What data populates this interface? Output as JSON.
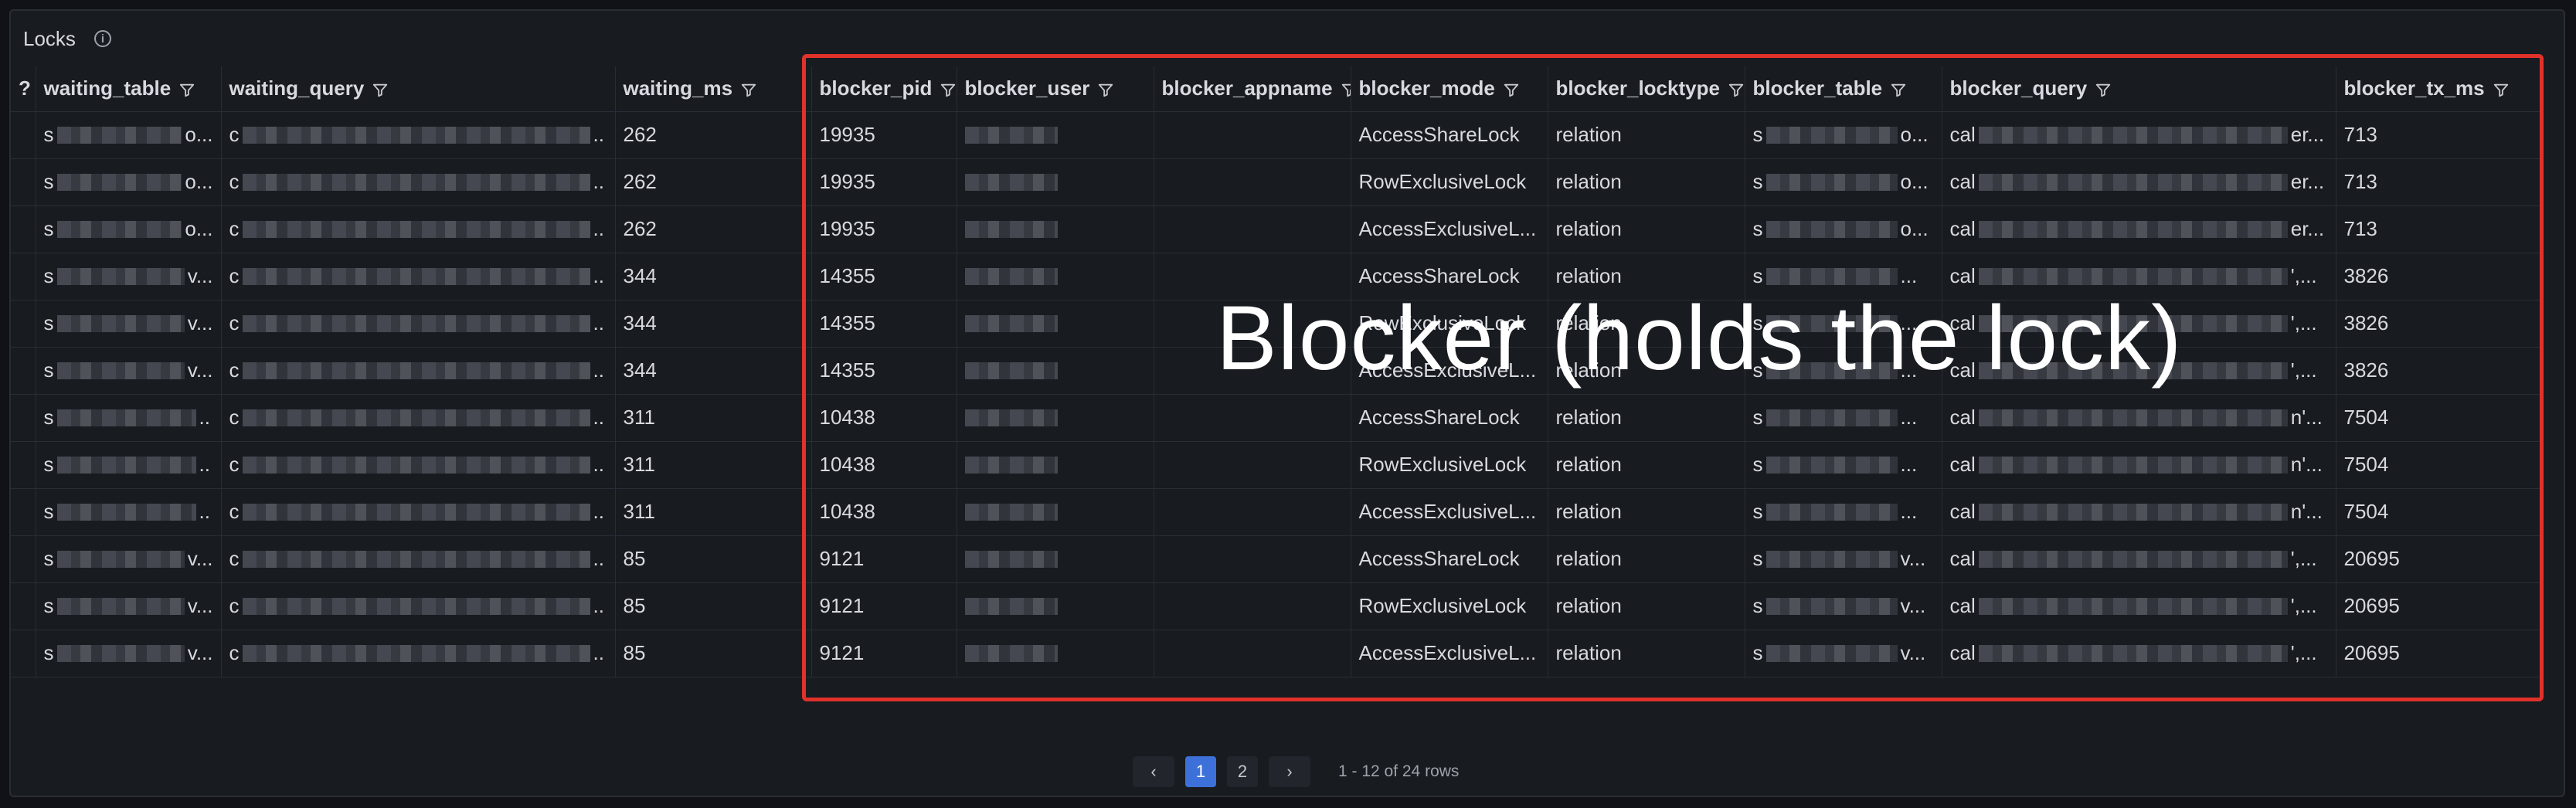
{
  "panel": {
    "title": "Locks",
    "info_icon": "info-icon"
  },
  "columns": [
    {
      "key": "c0",
      "label": "?"
    },
    {
      "key": "waiting_table",
      "label": "waiting_table"
    },
    {
      "key": "waiting_query",
      "label": "waiting_query"
    },
    {
      "key": "waiting_ms",
      "label": "waiting_ms"
    },
    {
      "key": "blocker_pid",
      "label": "blocker_pid"
    },
    {
      "key": "blocker_user",
      "label": "blocker_user"
    },
    {
      "key": "blocker_appname",
      "label": "blocker_appname"
    },
    {
      "key": "blocker_mode",
      "label": "blocker_mode"
    },
    {
      "key": "blocker_locktype",
      "label": "blocker_locktype"
    },
    {
      "key": "blocker_table",
      "label": "blocker_table"
    },
    {
      "key": "blocker_query",
      "label": "blocker_query"
    },
    {
      "key": "blocker_tx_ms",
      "label": "blocker_tx_ms"
    }
  ],
  "rows": [
    {
      "wt_pre": "s",
      "wt_suf": "o...",
      "wq_pre": "c",
      "wq_suf": "..",
      "waiting_ms": "262",
      "blocker_pid": "19935",
      "bu_pre": "",
      "blocker_appname": "",
      "blocker_mode": "AccessShareLock",
      "blocker_locktype": "relation",
      "bt_pre": "s",
      "bt_suf": "o...",
      "bq_pre": "cal",
      "bq_suf": "er...",
      "blocker_tx_ms": "713"
    },
    {
      "wt_pre": "s",
      "wt_suf": "o...",
      "wq_pre": "c",
      "wq_suf": "..",
      "waiting_ms": "262",
      "blocker_pid": "19935",
      "bu_pre": "",
      "blocker_appname": "",
      "blocker_mode": "RowExclusiveLock",
      "blocker_locktype": "relation",
      "bt_pre": "s",
      "bt_suf": "o...",
      "bq_pre": "cal",
      "bq_suf": "er...",
      "blocker_tx_ms": "713"
    },
    {
      "wt_pre": "s",
      "wt_suf": "o...",
      "wq_pre": "c",
      "wq_suf": "..",
      "waiting_ms": "262",
      "blocker_pid": "19935",
      "bu_pre": "",
      "blocker_appname": "",
      "blocker_mode": "AccessExclusiveL...",
      "blocker_locktype": "relation",
      "bt_pre": "s",
      "bt_suf": "o...",
      "bq_pre": "cal",
      "bq_suf": "er...",
      "blocker_tx_ms": "713"
    },
    {
      "wt_pre": "s",
      "wt_suf": "v...",
      "wq_pre": "c",
      "wq_suf": "..",
      "waiting_ms": "344",
      "blocker_pid": "14355",
      "bu_pre": "",
      "blocker_appname": "",
      "blocker_mode": "AccessShareLock",
      "blocker_locktype": "relation",
      "bt_pre": "s",
      "bt_suf": "...",
      "bq_pre": "cal",
      "bq_suf": "',...",
      "blocker_tx_ms": "3826"
    },
    {
      "wt_pre": "s",
      "wt_suf": "v...",
      "wq_pre": "c",
      "wq_suf": "..",
      "waiting_ms": "344",
      "blocker_pid": "14355",
      "bu_pre": "",
      "blocker_appname": "",
      "blocker_mode": "RowExclusiveLock",
      "blocker_locktype": "relation",
      "bt_pre": "s",
      "bt_suf": "...",
      "bq_pre": "cal",
      "bq_suf": "',...",
      "blocker_tx_ms": "3826"
    },
    {
      "wt_pre": "s",
      "wt_suf": "v...",
      "wq_pre": "c",
      "wq_suf": "..",
      "waiting_ms": "344",
      "blocker_pid": "14355",
      "bu_pre": "",
      "blocker_appname": "",
      "blocker_mode": "AccessExclusiveL...",
      "blocker_locktype": "relation",
      "bt_pre": "s",
      "bt_suf": "...",
      "bq_pre": "cal",
      "bq_suf": "',...",
      "blocker_tx_ms": "3826"
    },
    {
      "wt_pre": "s",
      "wt_suf": "..",
      "wq_pre": "c",
      "wq_suf": "..",
      "waiting_ms": "311",
      "blocker_pid": "10438",
      "bu_pre": "",
      "blocker_appname": "",
      "blocker_mode": "AccessShareLock",
      "blocker_locktype": "relation",
      "bt_pre": "s",
      "bt_suf": "...",
      "bq_pre": "cal",
      "bq_suf": "n'...",
      "blocker_tx_ms": "7504"
    },
    {
      "wt_pre": "s",
      "wt_suf": "..",
      "wq_pre": "c",
      "wq_suf": "..",
      "waiting_ms": "311",
      "blocker_pid": "10438",
      "bu_pre": "",
      "blocker_appname": "",
      "blocker_mode": "RowExclusiveLock",
      "blocker_locktype": "relation",
      "bt_pre": "s",
      "bt_suf": "...",
      "bq_pre": "cal",
      "bq_suf": "n'...",
      "blocker_tx_ms": "7504"
    },
    {
      "wt_pre": "s",
      "wt_suf": "..",
      "wq_pre": "c",
      "wq_suf": "..",
      "waiting_ms": "311",
      "blocker_pid": "10438",
      "bu_pre": "",
      "blocker_appname": "",
      "blocker_mode": "AccessExclusiveL...",
      "blocker_locktype": "relation",
      "bt_pre": "s",
      "bt_suf": "...",
      "bq_pre": "cal",
      "bq_suf": "n'...",
      "blocker_tx_ms": "7504"
    },
    {
      "wt_pre": "s",
      "wt_suf": "v...",
      "wq_pre": "c",
      "wq_suf": "..",
      "waiting_ms": "85",
      "blocker_pid": "9121",
      "bu_pre": "",
      "blocker_appname": "",
      "blocker_mode": "AccessShareLock",
      "blocker_locktype": "relation",
      "bt_pre": "s",
      "bt_suf": "v...",
      "bq_pre": "cal",
      "bq_suf": "',...",
      "blocker_tx_ms": "20695"
    },
    {
      "wt_pre": "s",
      "wt_suf": "v...",
      "wq_pre": "c",
      "wq_suf": "..",
      "waiting_ms": "85",
      "blocker_pid": "9121",
      "bu_pre": "",
      "blocker_appname": "",
      "blocker_mode": "RowExclusiveLock",
      "blocker_locktype": "relation",
      "bt_pre": "s",
      "bt_suf": "v...",
      "bq_pre": "cal",
      "bq_suf": "',...",
      "blocker_tx_ms": "20695"
    },
    {
      "wt_pre": "s",
      "wt_suf": "v...",
      "wq_pre": "c",
      "wq_suf": "..",
      "waiting_ms": "85",
      "blocker_pid": "9121",
      "bu_pre": "",
      "blocker_appname": "",
      "blocker_mode": "AccessExclusiveL...",
      "blocker_locktype": "relation",
      "bt_pre": "s",
      "bt_suf": "v...",
      "bq_pre": "cal",
      "bq_suf": "',...",
      "blocker_tx_ms": "20695"
    }
  ],
  "annotation": {
    "label": "Blocker (holds the lock)",
    "color": "#e0322b"
  },
  "pagination": {
    "prev_icon": "‹",
    "next_icon": "›",
    "pages": [
      "1",
      "2"
    ],
    "active_page": "1",
    "summary": "1 - 12 of 24 rows"
  },
  "colors": {
    "accent": "#3d71d9",
    "background": "#111217",
    "panel": "#181b1f"
  }
}
